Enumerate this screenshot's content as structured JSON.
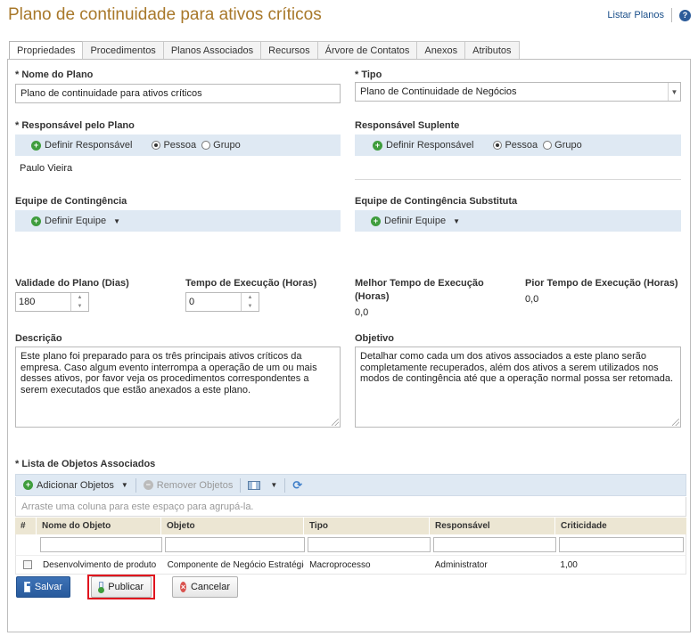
{
  "page": {
    "title": "Plano de continuidade para ativos críticos",
    "list_plans_link": "Listar Planos",
    "help_glyph": "?"
  },
  "tabs": [
    {
      "label": "Propriedades",
      "active": true
    },
    {
      "label": "Procedimentos"
    },
    {
      "label": "Planos Associados"
    },
    {
      "label": "Recursos"
    },
    {
      "label": "Árvore de Contatos"
    },
    {
      "label": "Anexos"
    },
    {
      "label": "Atributos"
    }
  ],
  "form": {
    "plan_name_label": "* Nome do Plano",
    "plan_name_value": "Plano de continuidade para ativos críticos",
    "type_label": "* Tipo",
    "type_value": "Plano de Continuidade de Negócios",
    "owner_label": "* Responsável pelo Plano",
    "owner_define": "Definir Responsável",
    "owner_person": "Pessoa",
    "owner_group": "Grupo",
    "owner_value": "Paulo Vieira",
    "substitute_label": "Responsável Suplente",
    "substitute_define": "Definir Responsável",
    "substitute_person": "Pessoa",
    "substitute_group": "Grupo",
    "team_label": "Equipe de Contingência",
    "team_define": "Definir Equipe",
    "substitute_team_label": "Equipe de Contingência Substituta",
    "substitute_team_define": "Definir Equipe",
    "validity_label": "Validade do Plano (Dias)",
    "validity_value": "180",
    "exec_time_label": "Tempo de Execução (Horas)",
    "exec_time_value": "0",
    "best_time_label_1": "Melhor Tempo de Execução",
    "best_time_label_2": "(Horas)",
    "best_time_value": "0,0",
    "worst_time_label": "Pior Tempo de Execução (Horas)",
    "worst_time_value": "0,0",
    "description_label": "Descrição",
    "description_value": "Este plano foi preparado para os três principais ativos críticos da empresa. Caso algum evento interrompa a operação de um ou mais desses ativos, por favor veja os procedimentos correspondentes a serem executados que estão anexados a este plano.",
    "objective_label": "Objetivo",
    "objective_value": "Detalhar como cada um dos ativos associados a este plano serão completamente recuperados, além dos ativos a serem utilizados nos modos de contingência até que a operação normal possa ser retomada."
  },
  "objects": {
    "label": "* Lista de Objetos Associados",
    "add_button": "Adicionar Objetos",
    "remove_button": "Remover Objetos",
    "group_hint": "Arraste uma coluna para este espaço para agrupá-la.",
    "columns": [
      "#",
      "Nome do Objeto",
      "Objeto",
      "Tipo",
      "Responsável",
      "Criticidade"
    ],
    "rows": [
      {
        "name": "Desenvolvimento de produto",
        "object": "Componente de Negócio Estratégico",
        "type": "Macroprocesso",
        "owner": "Administrator",
        "criticality": "1,00"
      }
    ]
  },
  "actions": {
    "save": "Salvar",
    "publish": "Publicar",
    "cancel": "Cancelar"
  }
}
